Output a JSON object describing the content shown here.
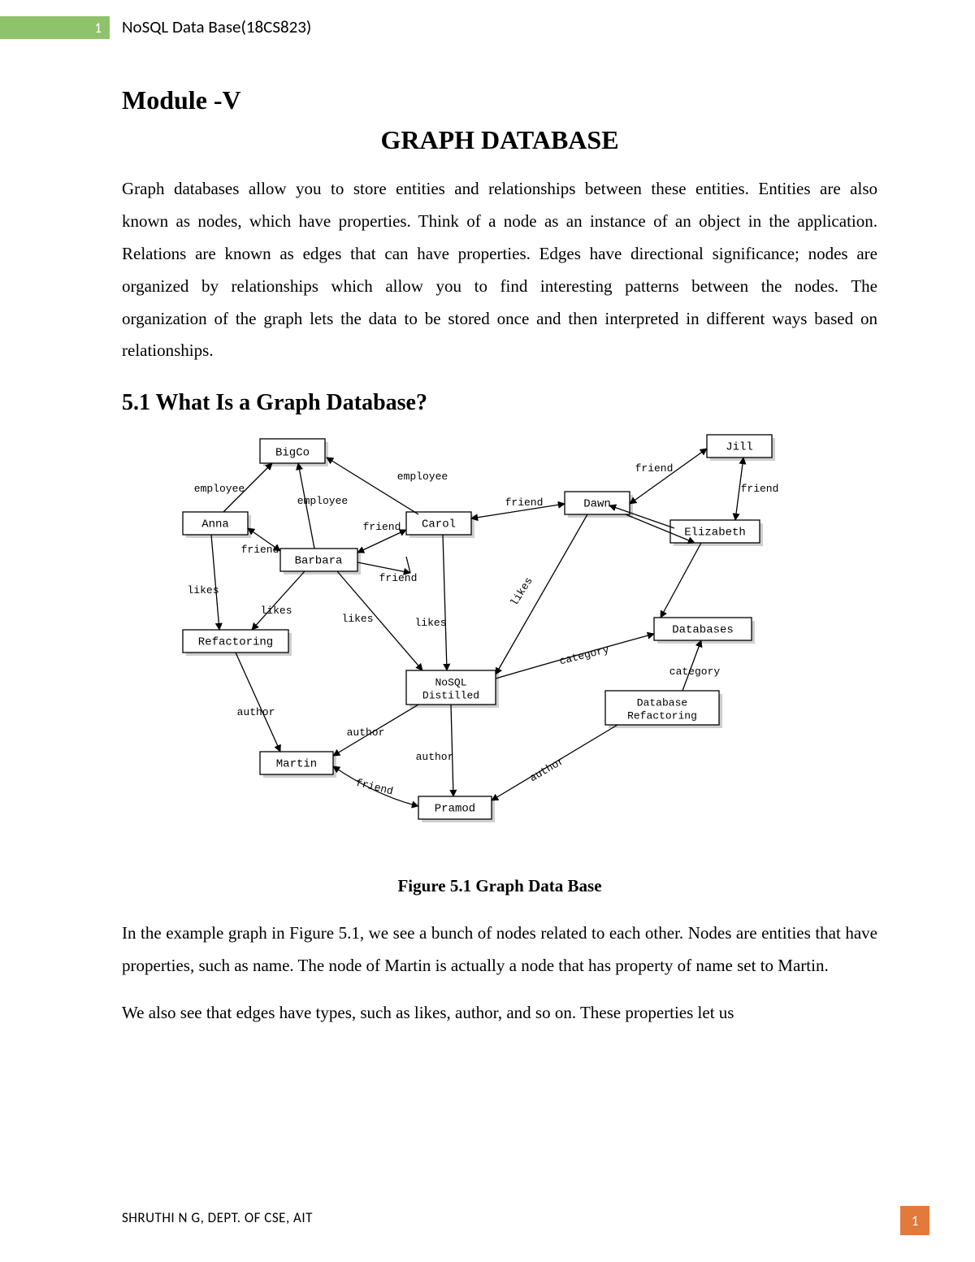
{
  "header": {
    "page_marker": "1",
    "course": "NoSQL Data Base(18CS823)"
  },
  "module": "Module -V",
  "chapter_title": "GRAPH DATABASE",
  "intro": "Graph databases allow you to store entities and relationships between these entities. Entities are also known as nodes, which have properties. Think of a node as an instance of an object in the application. Relations are known as edges that can have properties. Edges have directional significance; nodes are organized by relationships which allow you to find interesting patterns between the nodes. The organization of the graph lets the data to be stored once and then interpreted in different ways based on relationships.",
  "section_5_1": "5.1 What Is a Graph Database?",
  "figure_caption": "Figure 5.1 Graph Data Base",
  "para2": "In the example graph in Figure 5.1, we see a bunch of nodes related to each other. Nodes are entities that have properties, such as name. The node of Martin is actually a node that has property of name set to Martin.",
  "para3": "We also see that edges have types, such as likes, author, and so on. These properties let us",
  "footer": {
    "author": "SHRUTHI N G, DEPT. OF CSE, AIT",
    "page": "1"
  },
  "diagram": {
    "nodes": {
      "BigCo": "BigCo",
      "Jill": "Jill",
      "Anna": "Anna",
      "Carol": "Carol",
      "Dawn": "Dawn",
      "Elizabeth": "Elizabeth",
      "Barbara": "Barbara",
      "Refactoring": "Refactoring",
      "Databases": "Databases",
      "NoSQL_Distilled_1": "NoSQL",
      "NoSQL_Distilled_2": "Distilled",
      "DBRef_1": "Database",
      "DBRef_2": "Refactoring",
      "Martin": "Martin",
      "Pramod": "Pramod"
    },
    "edge_labels": {
      "employee1": "employee",
      "employee2": "employee",
      "employee3": "employee",
      "friend1": "friend",
      "friend2": "friend",
      "friend3": "friend",
      "friend4": "friend",
      "friend5": "friend",
      "friend6": "friend",
      "friend7": "friend",
      "likes1": "likes",
      "likes2": "likes",
      "likes3": "likes",
      "likes4": "likes",
      "likes5": "likes",
      "author1": "author",
      "author2": "author",
      "author3": "author",
      "author4": "author",
      "category1": "category",
      "category2": "category"
    }
  }
}
